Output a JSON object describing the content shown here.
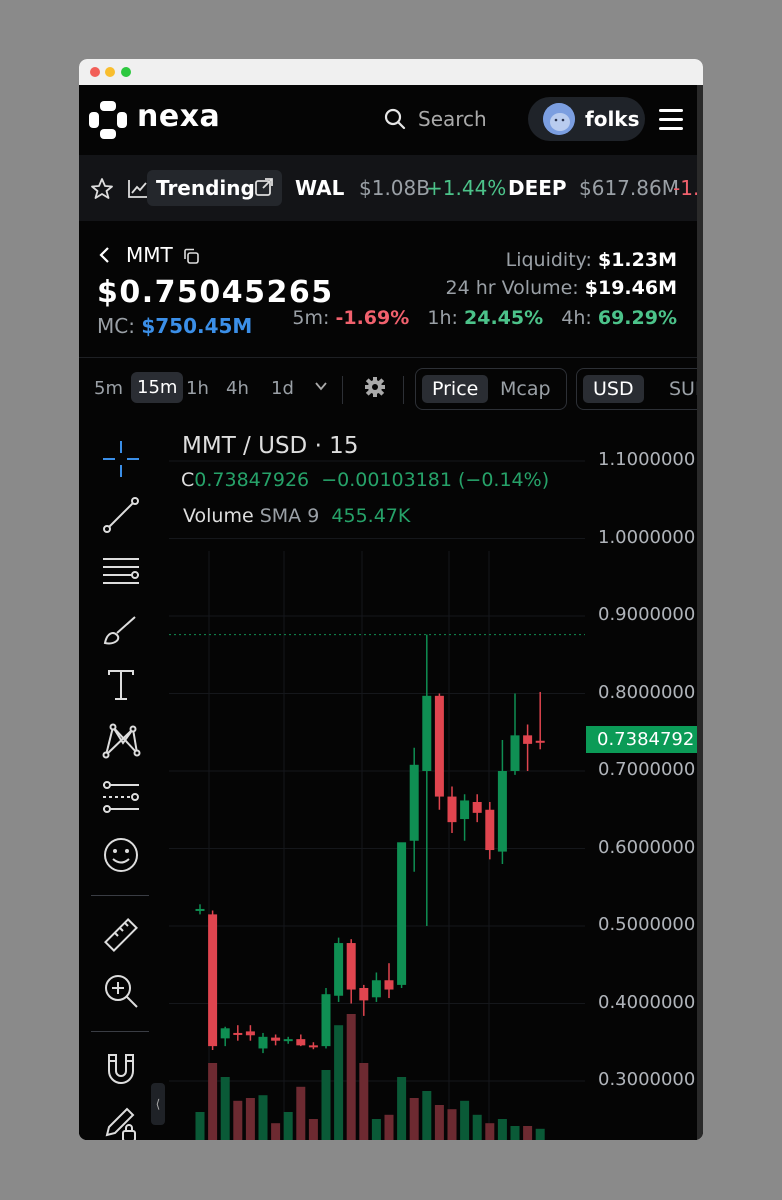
{
  "header": {
    "brand": "nexa",
    "search_placeholder": "Search",
    "username": "folks"
  },
  "ticker": {
    "trending_label": "Trending",
    "items": [
      {
        "symbol": "WAL",
        "price": "$1.08B",
        "change": "+1.44%",
        "dir": "up"
      },
      {
        "symbol": "DEEP",
        "price": "$617.86M",
        "change": "-1.",
        "dir": "down"
      }
    ]
  },
  "token": {
    "symbol": "MMT",
    "price": "$0.75045265",
    "mc_label": "MC:",
    "mc_value": "$750.45M",
    "liquidity_label": "Liquidity:",
    "liquidity_value": "$1.23M",
    "volume_label": "24 hr Volume:",
    "volume_value": "$19.46M",
    "changes": [
      {
        "label": "5m:",
        "value": "-1.69%",
        "dir": "down"
      },
      {
        "label": "1h:",
        "value": "24.45%",
        "dir": "up"
      },
      {
        "label": "4h:",
        "value": "69.29%",
        "dir": "up"
      }
    ]
  },
  "toolbar": {
    "timeframes": [
      "5m",
      "15m",
      "1h",
      "4h",
      "1d"
    ],
    "active_timeframe": "15m",
    "price_mode": [
      "Price",
      "Mcap"
    ],
    "active_price_mode": "Price",
    "currency": [
      "USD",
      "SUI"
    ],
    "active_currency": "USD"
  },
  "chart_data": {
    "type": "candlestick",
    "title": "MMT / USD · 15",
    "close_label": "C",
    "close_value": "0.73847926",
    "change_value": "−0.00103181 (−0.14%)",
    "volume_label": "Volume",
    "sma_label": "SMA 9",
    "volume_value": "455.47K",
    "last_price_tag": "0.7384792",
    "y_tick_labels": [
      "1.1000000",
      "1.0000000",
      "0.9000000",
      "0.8000000",
      "0.7000000",
      "0.6000000",
      "0.5000000",
      "0.4000000",
      "0.3000000"
    ],
    "y_ticks": [
      1.1,
      1.0,
      0.9,
      0.8,
      0.7,
      0.6,
      0.5,
      0.4,
      0.3
    ],
    "ylim": [
      0.25,
      1.15
    ],
    "high_line": 0.876,
    "candles": [
      {
        "o": 0.52,
        "h": 0.528,
        "l": 0.515,
        "c": 0.522
      },
      {
        "o": 0.515,
        "h": 0.52,
        "l": 0.34,
        "c": 0.345
      },
      {
        "o": 0.355,
        "h": 0.37,
        "l": 0.345,
        "c": 0.368
      },
      {
        "o": 0.362,
        "h": 0.372,
        "l": 0.352,
        "c": 0.36
      },
      {
        "o": 0.364,
        "h": 0.372,
        "l": 0.352,
        "c": 0.359
      },
      {
        "o": 0.342,
        "h": 0.362,
        "l": 0.336,
        "c": 0.357
      },
      {
        "o": 0.356,
        "h": 0.36,
        "l": 0.346,
        "c": 0.352
      },
      {
        "o": 0.353,
        "h": 0.357,
        "l": 0.348,
        "c": 0.354
      },
      {
        "o": 0.354,
        "h": 0.36,
        "l": 0.345,
        "c": 0.346
      },
      {
        "o": 0.346,
        "h": 0.35,
        "l": 0.341,
        "c": 0.345
      },
      {
        "o": 0.345,
        "h": 0.42,
        "l": 0.342,
        "c": 0.412
      },
      {
        "o": 0.41,
        "h": 0.485,
        "l": 0.402,
        "c": 0.478
      },
      {
        "o": 0.478,
        "h": 0.483,
        "l": 0.4,
        "c": 0.418
      },
      {
        "o": 0.42,
        "h": 0.424,
        "l": 0.384,
        "c": 0.404
      },
      {
        "o": 0.408,
        "h": 0.44,
        "l": 0.402,
        "c": 0.43
      },
      {
        "o": 0.43,
        "h": 0.452,
        "l": 0.407,
        "c": 0.418
      },
      {
        "o": 0.424,
        "h": 0.47,
        "l": 0.42,
        "c": 0.608
      },
      {
        "o": 0.61,
        "h": 0.73,
        "l": 0.57,
        "c": 0.708
      },
      {
        "o": 0.7,
        "h": 0.876,
        "l": 0.5,
        "c": 0.797
      },
      {
        "o": 0.797,
        "h": 0.8,
        "l": 0.65,
        "c": 0.667
      },
      {
        "o": 0.667,
        "h": 0.68,
        "l": 0.62,
        "c": 0.634
      },
      {
        "o": 0.638,
        "h": 0.67,
        "l": 0.61,
        "c": 0.662
      },
      {
        "o": 0.66,
        "h": 0.67,
        "l": 0.634,
        "c": 0.646
      },
      {
        "o": 0.65,
        "h": 0.66,
        "l": 0.586,
        "c": 0.598
      },
      {
        "o": 0.596,
        "h": 0.74,
        "l": 0.58,
        "c": 0.7
      },
      {
        "o": 0.7,
        "h": 0.8,
        "l": 0.695,
        "c": 0.746
      },
      {
        "o": 0.746,
        "h": 0.76,
        "l": 0.7,
        "c": 0.735
      },
      {
        "o": 0.739,
        "h": 0.802,
        "l": 0.728,
        "c": 0.738
      }
    ],
    "volumes": [
      {
        "v": 0.2,
        "up": true
      },
      {
        "v": 0.55,
        "up": false
      },
      {
        "v": 0.45,
        "up": true
      },
      {
        "v": 0.28,
        "up": false
      },
      {
        "v": 0.3,
        "up": false
      },
      {
        "v": 0.32,
        "up": true
      },
      {
        "v": 0.12,
        "up": false
      },
      {
        "v": 0.2,
        "up": true
      },
      {
        "v": 0.38,
        "up": false
      },
      {
        "v": 0.15,
        "up": false
      },
      {
        "v": 0.5,
        "up": true
      },
      {
        "v": 0.82,
        "up": true
      },
      {
        "v": 0.9,
        "up": false
      },
      {
        "v": 0.55,
        "up": false
      },
      {
        "v": 0.15,
        "up": true
      },
      {
        "v": 0.18,
        "up": false
      },
      {
        "v": 0.45,
        "up": true
      },
      {
        "v": 0.3,
        "up": false
      },
      {
        "v": 0.35,
        "up": true
      },
      {
        "v": 0.25,
        "up": false
      },
      {
        "v": 0.22,
        "up": false
      },
      {
        "v": 0.28,
        "up": true
      },
      {
        "v": 0.18,
        "up": true
      },
      {
        "v": 0.12,
        "up": false
      },
      {
        "v": 0.15,
        "up": true
      },
      {
        "v": 0.1,
        "up": true
      },
      {
        "v": 0.1,
        "up": false
      },
      {
        "v": 0.08,
        "up": true
      }
    ]
  },
  "colors": {
    "up": "#0f8f53",
    "down": "#e0454f",
    "accent": "#3b8fe8"
  },
  "drawing_tools": [
    "crosshair-icon",
    "trendline-icon",
    "horizontal-lines-icon",
    "brush-icon",
    "text-icon",
    "pattern-icon",
    "forecast-icon",
    "emoji-icon",
    "ruler-icon",
    "zoom-in-icon",
    "magnet-icon",
    "lock-drawing-icon"
  ]
}
